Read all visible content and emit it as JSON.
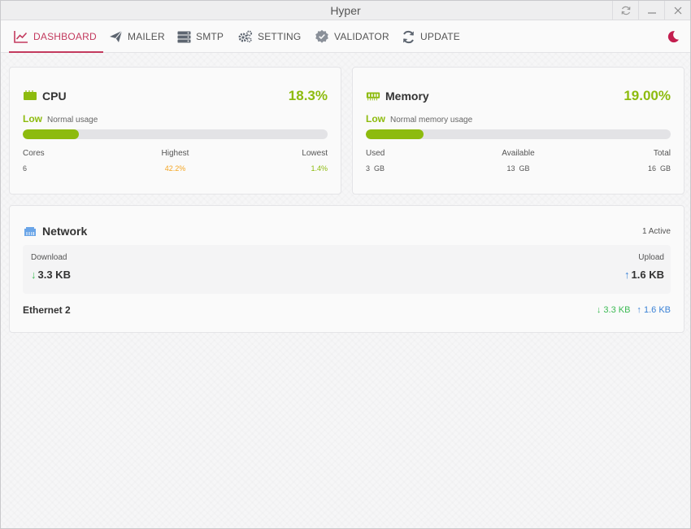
{
  "window": {
    "title": "Hyper"
  },
  "nav": {
    "items": [
      {
        "label": "DASHBOARD",
        "icon": "chart-line-icon",
        "active": true
      },
      {
        "label": "MAILER",
        "icon": "paper-plane-icon",
        "active": false
      },
      {
        "label": "SMTP",
        "icon": "server-icon",
        "active": false
      },
      {
        "label": "SETTING",
        "icon": "gears-icon",
        "active": false
      },
      {
        "label": "VALIDATOR",
        "icon": "badge-check-icon",
        "active": false
      },
      {
        "label": "UPDATE",
        "icon": "refresh-icon",
        "active": false
      }
    ],
    "theme_icon": "moon-icon"
  },
  "colors": {
    "accent": "#c33a5e",
    "good": "#8dbb0e",
    "warning": "#f5a623",
    "download": "#3cba54",
    "upload": "#3b82d6"
  },
  "cpu": {
    "title": "CPU",
    "value": "18.3%",
    "level": "Low",
    "description": "Normal usage",
    "progress": 0.183,
    "stats": {
      "cores_label": "Cores",
      "cores_value": "6",
      "highest_label": "Highest",
      "highest_value": "42.2%",
      "lowest_label": "Lowest",
      "lowest_value": "1.4%"
    }
  },
  "memory": {
    "title": "Memory",
    "value": "19.00%",
    "level": "Low",
    "description": "Normal memory usage",
    "progress": 0.19,
    "stats": {
      "used_label": "Used",
      "used_value": "3  GB",
      "available_label": "Available",
      "available_value": "13  GB",
      "total_label": "Total",
      "total_value": "16  GB"
    }
  },
  "network": {
    "title": "Network",
    "active": "1 Active",
    "download_label": "Download",
    "download_value": "3.3 KB",
    "upload_label": "Upload",
    "upload_value": "1.6 KB",
    "interfaces": [
      {
        "name": "Ethernet 2",
        "down": "↓ 3.3 KB",
        "up": "↑ 1.6 KB"
      }
    ]
  }
}
